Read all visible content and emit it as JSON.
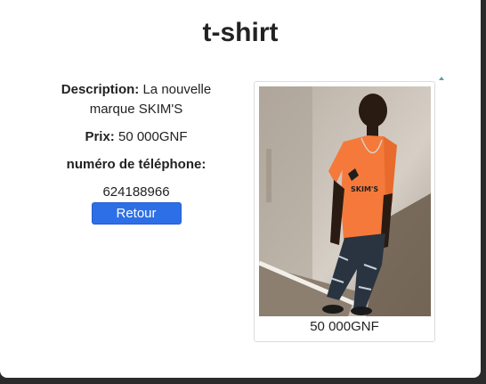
{
  "product": {
    "title": "t-shirt",
    "description_label": "Description:",
    "description_value": " La nouvelle marque SKIM'S",
    "price_label": "Prix:",
    "price_value": " 50 000GNF",
    "phone_label": "numéro de téléphone:",
    "phone_value": "624188966",
    "back_button": "Retour",
    "image_caption": "50 000GNF"
  },
  "colors": {
    "button": "#2d6fe6",
    "shirt": "#f5793a"
  },
  "icons": [
    "scroll-up-arrow-icon"
  ]
}
